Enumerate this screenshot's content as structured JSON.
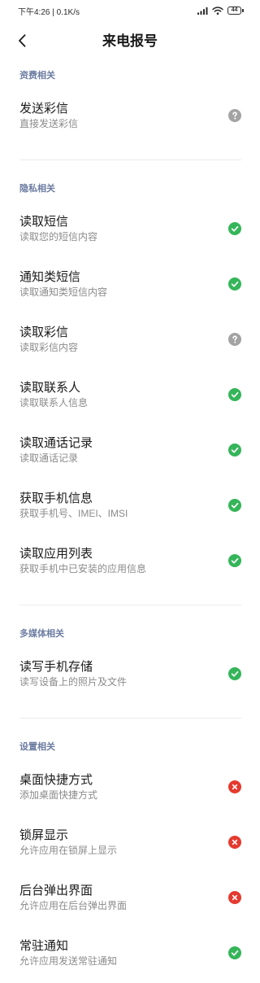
{
  "status_bar": {
    "text": "下午4:26 | 0.1K/s",
    "battery": "44",
    "icons": [
      "signal-icon",
      "wifi-icon",
      "battery-icon"
    ]
  },
  "header": {
    "title": "来电报号",
    "back_icon": "chevron-left-icon"
  },
  "colors": {
    "section_title": "#6b7ba1",
    "text_primary": "#1a1a1a",
    "text_secondary": "#8b8b8b",
    "divider": "#ebebeb",
    "status_bar": "#2b2b2b"
  },
  "icon_colors": {
    "check-circle-icon": "#35b559",
    "question-circle-icon": "#a3a3a3",
    "cross-circle-icon": "#e53a2f"
  },
  "sections": [
    {
      "title": "资费相关",
      "items": [
        {
          "title": "发送彩信",
          "subtitle": "直接发送彩信",
          "icon": "question-circle-icon"
        }
      ]
    },
    {
      "title": "隐私相关",
      "items": [
        {
          "title": "读取短信",
          "subtitle": "读取您的短信内容",
          "icon": "check-circle-icon"
        },
        {
          "title": "通知类短信",
          "subtitle": "读取通知类短信内容",
          "icon": "check-circle-icon"
        },
        {
          "title": "读取彩信",
          "subtitle": "读取彩信内容",
          "icon": "question-circle-icon"
        },
        {
          "title": "读取联系人",
          "subtitle": "读取联系人信息",
          "icon": "check-circle-icon"
        },
        {
          "title": "读取通话记录",
          "subtitle": "读取通话记录",
          "icon": "check-circle-icon"
        },
        {
          "title": "获取手机信息",
          "subtitle": "获取手机号、IMEI、IMSI",
          "icon": "check-circle-icon"
        },
        {
          "title": "读取应用列表",
          "subtitle": "获取手机中已安装的应用信息",
          "icon": "check-circle-icon"
        }
      ]
    },
    {
      "title": "多媒体相关",
      "items": [
        {
          "title": "读写手机存储",
          "subtitle": "读写设备上的照片及文件",
          "icon": "check-circle-icon"
        }
      ]
    },
    {
      "title": "设置相关",
      "items": [
        {
          "title": "桌面快捷方式",
          "subtitle": "添加桌面快捷方式",
          "icon": "cross-circle-icon"
        },
        {
          "title": "锁屏显示",
          "subtitle": "允许应用在锁屏上显示",
          "icon": "cross-circle-icon"
        },
        {
          "title": "后台弹出界面",
          "subtitle": "允许应用在后台弹出界面",
          "icon": "cross-circle-icon"
        },
        {
          "title": "常驻通知",
          "subtitle": "允许应用发送常驻通知",
          "icon": "check-circle-icon"
        }
      ]
    }
  ]
}
